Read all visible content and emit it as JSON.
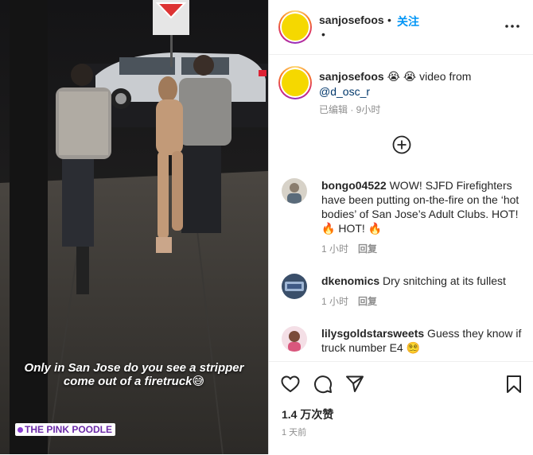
{
  "video": {
    "caption_line1": "Only in San Jose do you see a stripper",
    "caption_line2": "come out of a firetruck😅",
    "watermark": "THE PINK POODLE"
  },
  "header": {
    "username": "sanjosefoos",
    "separator": "•",
    "follow_label": "关注",
    "second_line_dot": "•",
    "more_icon": "more-horizontal-icon"
  },
  "post_caption": {
    "username": "sanjosefoos",
    "emojis": "😭 😭",
    "text": " video from",
    "mention": "@d_osc_r",
    "meta": "已编辑 · 9小时"
  },
  "load_more_icon": "plus-circle-icon",
  "comments": [
    {
      "username": "bongo04522",
      "text_before": " WOW! SJFD Firefighters have been putting on-the-fire on the ‘hot bodies’ of San Jose’s Adult Clubs. HOT!",
      "flame1": "🔥",
      "text_mid": " HOT! ",
      "flame2": "🔥",
      "time": "1 小时",
      "reply": "回复"
    },
    {
      "username": "dkenomics",
      "text": " Dry snitching at its fullest",
      "time": "1 小时",
      "reply": "回复"
    },
    {
      "username": "lilysgoldstarsweets",
      "text": " Guess they know if truck number E4",
      "emoji": "😵‍💫"
    }
  ],
  "actions": {
    "like_icon": "heart-icon",
    "comment_icon": "comment-icon",
    "share_icon": "send-icon",
    "save_icon": "bookmark-icon",
    "views": "1.4 万次赞",
    "posted": "1 天前"
  },
  "colors": {
    "link_blue": "#0095f6",
    "avatar_yellow": "#f5d800"
  }
}
